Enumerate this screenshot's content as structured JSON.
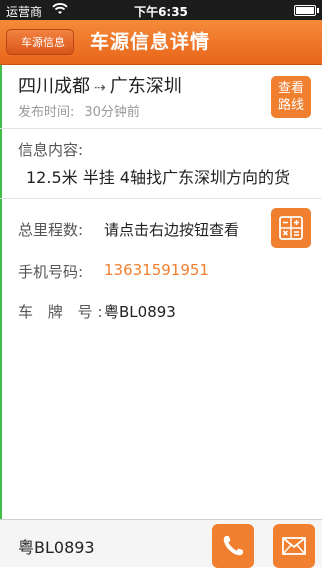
{
  "status_bar": {
    "carrier": "运营商",
    "time": "下午6:35"
  },
  "nav": {
    "back_label": "车源信息",
    "title": "车源信息详情"
  },
  "route": {
    "origin": "四川成都",
    "arrow": "⇢",
    "destination": "广东深圳"
  },
  "publish": {
    "label": "发布时间:",
    "value": "30分钟前"
  },
  "route_button": {
    "line1": "查看",
    "line2": "路线"
  },
  "info": {
    "label": "信息内容:",
    "content": "12.5米 半挂 4轴找广东深圳方向的货"
  },
  "mileage": {
    "label": "总里程数:",
    "value": "请点击右边按钮查看"
  },
  "phone": {
    "label": "手机号码:",
    "value": "13631591951"
  },
  "plate": {
    "label": "车 牌 号:",
    "value": "粤BL0893"
  },
  "bottom": {
    "plate": "粤BL0893"
  },
  "colors": {
    "accent": "#f07f2f",
    "nav": "#e8661a"
  },
  "icons": {
    "calculator": "calculator-icon",
    "phone": "phone-icon",
    "mail": "mail-icon"
  }
}
